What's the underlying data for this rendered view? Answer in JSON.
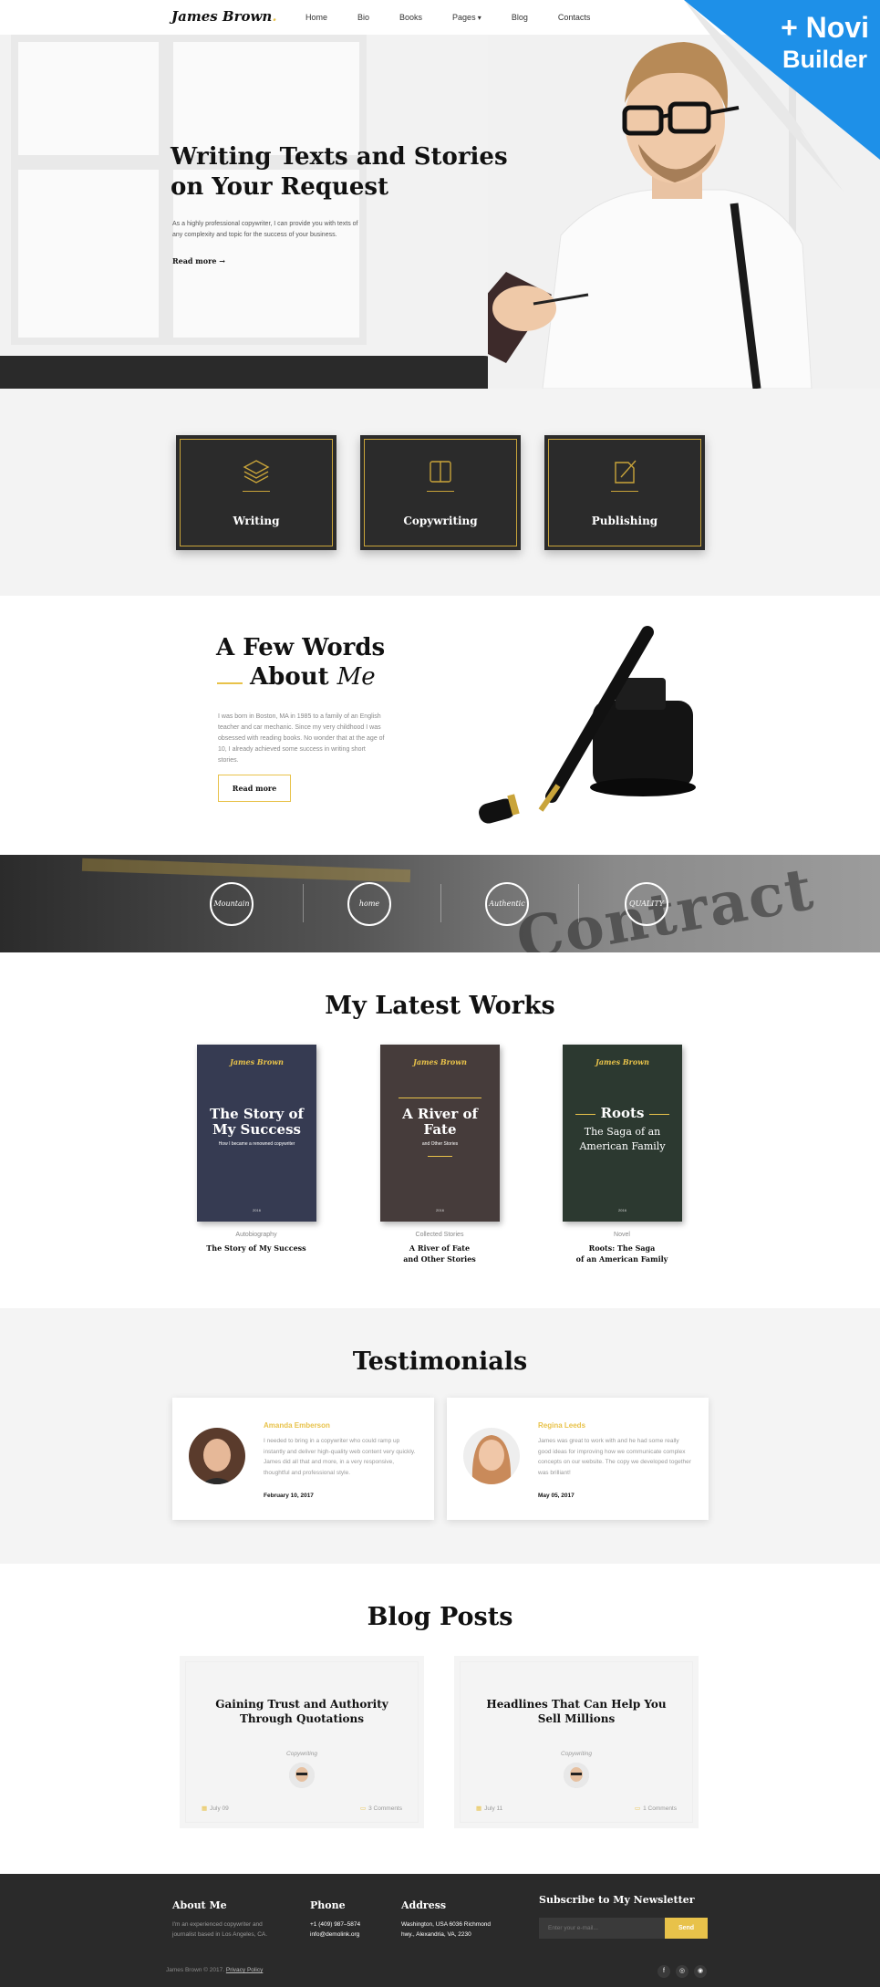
{
  "header": {
    "logo": "James Brown",
    "logo_dot": ".",
    "nav": [
      "Home",
      "Bio",
      "Books",
      "Pages",
      "Blog",
      "Contacts"
    ]
  },
  "badge": {
    "line1": "+ Novi",
    "line2": "Builder"
  },
  "hero": {
    "title_line1": "Writing Texts and Stories",
    "title_line2": "on Your Request",
    "text": "As a highly professional copywriter, I can provide you with texts of any complexity and topic for the success of your business.",
    "link": "Read more"
  },
  "services": [
    {
      "label": "Writing",
      "icon": "layers-icon"
    },
    {
      "label": "Copywriting",
      "icon": "book-icon"
    },
    {
      "label": "Publishing",
      "icon": "edit-document-icon"
    }
  ],
  "about": {
    "title_line1": "A Few Words",
    "title_line2_bold": "About",
    "title_line2_italic": "Me",
    "text": "I was born in Boston, MA in 1985 to a family of an English teacher and car mechanic. Since my very childhood I was obsessed with reading books. No wonder that at the age of 10, I already achieved some success in writing short stories.",
    "button": "Read more"
  },
  "badges_strip": {
    "labels": [
      "Mountain",
      "home",
      "Authentic",
      "QUALITY"
    ],
    "background_word": "Contract"
  },
  "works": {
    "title": "My Latest Works",
    "books": [
      {
        "brand": "James Brown",
        "cover_title": "The Story of My Success",
        "cover_sub": "How I became a renowned copywriter",
        "year": "2016",
        "category": "Autobiography",
        "caption": "The Story of My Success",
        "color": "#363b52"
      },
      {
        "brand": "James Brown",
        "cover_title": "A River of Fate",
        "cover_sub": "and Other Stories",
        "year": "2016",
        "category": "Collected Stories",
        "caption_line1": "A River of Fate",
        "caption_line2": "and Other Stories",
        "color": "#463c3b"
      },
      {
        "brand": "James Brown",
        "cover_title": "Roots",
        "cover_sub_line1": "The Saga of an",
        "cover_sub_line2": "American Family",
        "year": "2016",
        "category": "Novel",
        "caption_line1": "Roots: The Saga",
        "caption_line2": "of an American Family",
        "color": "#2c3930"
      }
    ]
  },
  "testimonials": {
    "title": "Testimonials",
    "items": [
      {
        "name": "Amanda Emberson",
        "text": "I needed to bring in a copywriter who could ramp up instantly and deliver high-quality web content very quickly. James did all that and more, in a very responsive, thoughtful and professional style.",
        "date": "February 10, 2017"
      },
      {
        "name": "Regina Leeds",
        "text": "James was great to work with and he had some really good ideas for improving how we communicate complex concepts on our website. The copy we developed together was brilliant!",
        "date": "May 05, 2017"
      }
    ]
  },
  "blog": {
    "title": "Blog Posts",
    "posts": [
      {
        "title_line1": "Gaining Trust and Authority",
        "title_line2": "Through Quotations",
        "category": "Copywriting",
        "date": "July 09",
        "comments": "3 Comments"
      },
      {
        "title_line1": "Headlines That Can Help You",
        "title_line2": "Sell Millions",
        "category": "Copywriting",
        "date": "July 11",
        "comments": "1 Comments"
      }
    ]
  },
  "footer": {
    "about_title": "About Me",
    "about_text_line1": "I'm an experienced copywriter and",
    "about_text_line2": "journalist based in Los Angeles, CA.",
    "phone_title": "Phone",
    "phone": "+1 (409) 987–5874",
    "email": "info@demolink.org",
    "address_title": "Address",
    "address_line1": "Washington, USA 6036 Richmond",
    "address_line2": "hwy., Alexandria, VA, 2230",
    "newsletter_title": "Subscribe to My Newsletter",
    "email_placeholder": "Enter your e-mail...",
    "send": "Send",
    "copyright": "James Brown © 2017.",
    "privacy": "Privacy Policy",
    "social": [
      "f",
      "◎",
      "◉"
    ]
  },
  "colors": {
    "accent": "#e8c24a",
    "dark": "#2b2b2b",
    "badge_blue": "#1e90e8"
  }
}
